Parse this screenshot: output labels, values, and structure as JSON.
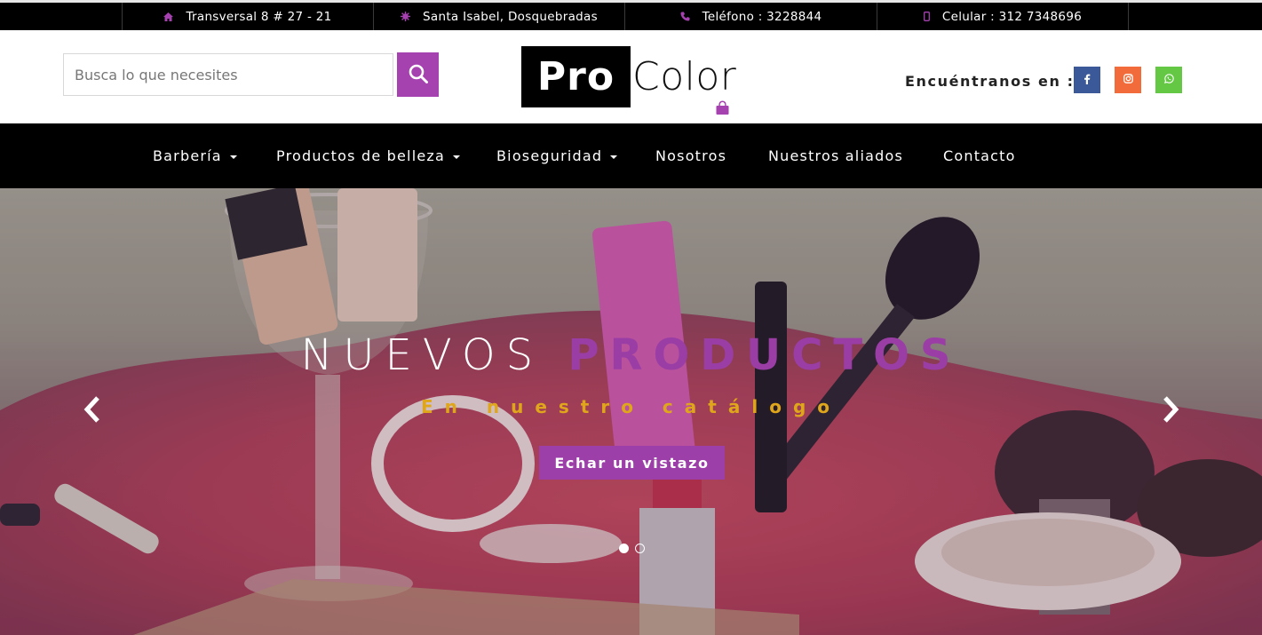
{
  "topbar": {
    "items": [
      {
        "icon": "home-icon",
        "text": "Transversal 8 # 27 - 21"
      },
      {
        "icon": "location-icon",
        "text": "Santa Isabel, Dosquebradas"
      },
      {
        "icon": "phone-icon",
        "text": "Teléfono : 3228844"
      },
      {
        "icon": "mobile-icon",
        "text": "Celular : 312 7348696"
      }
    ]
  },
  "header": {
    "search_placeholder": "Busca lo que necesites",
    "logo_pro": "Pro",
    "logo_color": "Color",
    "social_label": "Encuéntranos en :",
    "social": [
      "facebook-icon",
      "instagram-icon",
      "whatsapp-icon"
    ]
  },
  "nav": {
    "items": [
      {
        "label": "Barbería",
        "dropdown": true
      },
      {
        "label": "Productos de belleza",
        "dropdown": true
      },
      {
        "label": "Bioseguridad",
        "dropdown": true
      },
      {
        "label": "Nosotros",
        "dropdown": false
      },
      {
        "label": "Nuestros aliados",
        "dropdown": false
      },
      {
        "label": "Contacto",
        "dropdown": false
      }
    ]
  },
  "hero": {
    "title_part1": "NUEVOS",
    "title_part2": "PRODUCTOS",
    "subtitle": "En nuestro catálogo",
    "button_label": "Echar un vistazo",
    "slides_count": 2,
    "active_slide": 1
  },
  "colors": {
    "brand_purple": "#a641b0",
    "accent_gold": "#e0a61b",
    "nav_bg": "#000000",
    "facebook": "#3b5998",
    "instagram": "#f16c3a",
    "whatsapp": "#64c845"
  }
}
